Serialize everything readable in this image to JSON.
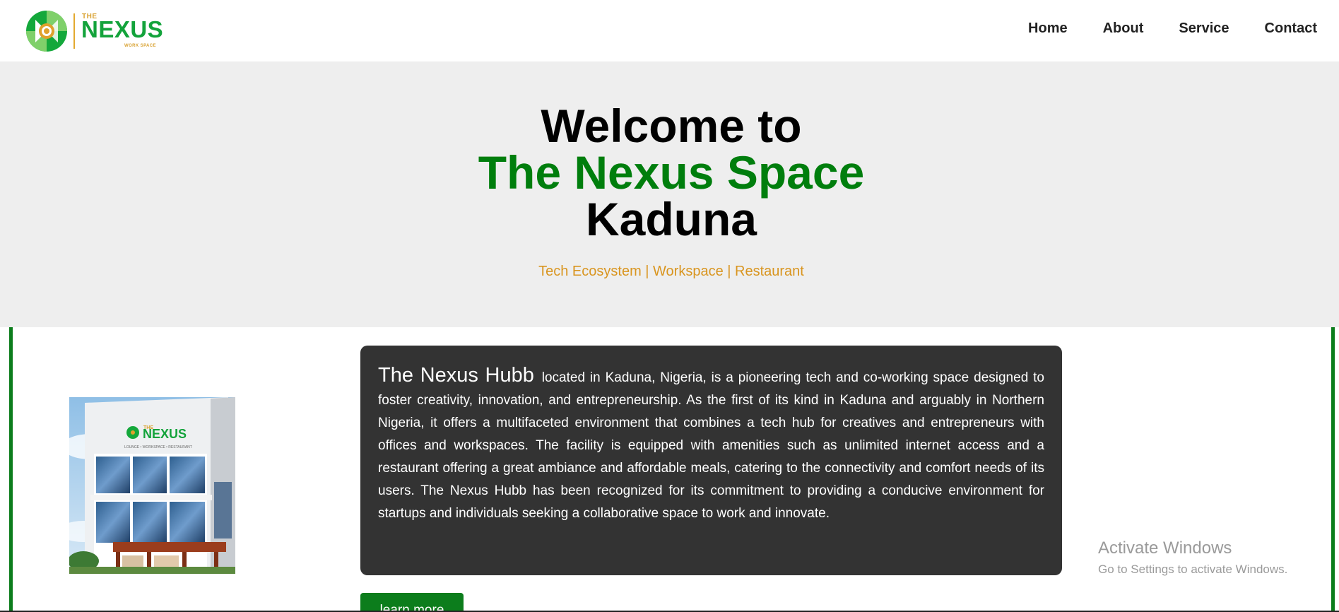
{
  "logo": {
    "the": "THE",
    "name": "NEXUS",
    "subtitle": "WORK SPACE",
    "colors": {
      "green": "#13a33b",
      "gold": "#d9a232"
    }
  },
  "nav": {
    "items": [
      {
        "label": "Home"
      },
      {
        "label": "About"
      },
      {
        "label": "Service"
      },
      {
        "label": "Contact"
      }
    ]
  },
  "hero": {
    "line1": "Welcome to",
    "line2": "The Nexus Space",
    "line3": "Kaduna",
    "tagline": "Tech Ecosystem | Workspace | Restaurant",
    "colors": {
      "background": "#eeeeee",
      "accent": "#007e0d",
      "tagline": "#d9951f"
    }
  },
  "building_image": {
    "sign_the": "THE",
    "sign_name": "NEXUS",
    "sign_sub": "LOUNGE • WORKSPACE • RESTAURANT"
  },
  "about": {
    "lead": "The Nexus Hubb",
    "body": "located in Kaduna, Nigeria, is a pioneering tech and co-working space designed to foster creativity, innovation, and entrepreneurship. As the first of its kind in Kaduna and arguably in Northern Nigeria, it offers a multifaceted environment that combines a tech hub for creatives and entrepreneurs with offices and workspaces. The facility is equipped with amenities such as unlimited internet access and a restaurant offering a great ambiance and affordable meals, catering to the connectivity and comfort needs of its users. The Nexus Hubb has been recognized for its commitment to providing a conducive environment for startups and individuals seeking a collaborative space to work and innovate.",
    "button_label": "learn more",
    "colors": {
      "card": "#333333",
      "button": "#0c7d1c"
    }
  },
  "watermark": {
    "title": "Activate Windows",
    "subtitle": "Go to Settings to activate Windows."
  }
}
